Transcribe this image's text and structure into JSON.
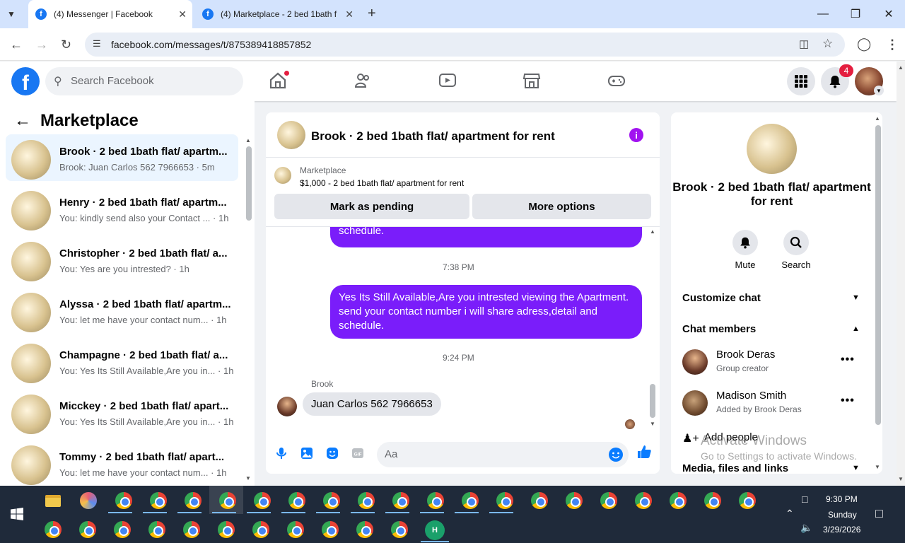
{
  "browser": {
    "tabs": [
      {
        "title": "(4) Messenger | Facebook",
        "active": true
      },
      {
        "title": "(4) Marketplace - 2 bed 1bath f",
        "active": false
      }
    ],
    "url": "facebook.com/messages/t/875389418857852"
  },
  "fb_header": {
    "logo": "f",
    "search_placeholder": "Search Facebook",
    "notifications_count": "4"
  },
  "sidebar": {
    "title": "Marketplace",
    "conversations": [
      {
        "name": "Brook · 2 bed 1bath flat/ apartm...",
        "preview": "Brook: Juan Carlos 562 7966653 · 5m",
        "selected": true
      },
      {
        "name": "Henry · 2 bed 1bath flat/ apartm...",
        "preview": "You: kindly send also your Contact ... · 1h"
      },
      {
        "name": "Christopher · 2 bed 1bath flat/ a...",
        "preview": "You: Yes are you intrested? · 1h"
      },
      {
        "name": "Alyssa · 2 bed 1bath flat/ apartm...",
        "preview": "You: let me have your contact num... · 1h"
      },
      {
        "name": "Champagne · 2 bed 1bath flat/ a...",
        "preview": "You: Yes Its Still Available,Are you in... · 1h"
      },
      {
        "name": "Micckey · 2 bed 1bath flat/ apart...",
        "preview": "You: Yes Its Still Available,Are you in... · 1h"
      },
      {
        "name": "Tommy · 2 bed 1bath flat/ apart...",
        "preview": "You: let me have your contact num... · 1h"
      }
    ]
  },
  "chat": {
    "title": "Brook · 2 bed 1bath flat/ apartment for rent",
    "marketplace_label": "Marketplace",
    "listing": "$1,000 - 2 bed 1bath flat/ apartment for rent",
    "mark_pending": "Mark as pending",
    "more_options": "More options",
    "partial_message": "schedule.",
    "time1": "7:38 PM",
    "outgoing_message": "Yes Its Still Available,Are you intrested viewing the Apartment. send your contact number i will share adress,detail and schedule.",
    "time2": "9:24 PM",
    "sender": "Brook",
    "incoming_message": "Juan Carlos 562 7966653",
    "composer_placeholder": "Aa"
  },
  "details": {
    "name": "Brook · 2 bed 1bath flat/ apartment for rent",
    "mute": "Mute",
    "search": "Search",
    "customize": "Customize chat",
    "members_title": "Chat members",
    "members": [
      {
        "name": "Brook Deras",
        "sub": "Group creator"
      },
      {
        "name": "Madison Smith",
        "sub": "Added by Brook Deras"
      }
    ],
    "add_people": "Add people",
    "media": "Media, files and links"
  },
  "watermark": {
    "line1": "Activate Windows",
    "line2": "Go to Settings to activate Windows."
  },
  "taskbar": {
    "time": "9:30 PM",
    "day": "Sunday",
    "date": "3/29/2026"
  },
  "colors": {
    "accent": "#1877f2",
    "bubble": "#7a1dfa",
    "info": "#a112f0"
  }
}
